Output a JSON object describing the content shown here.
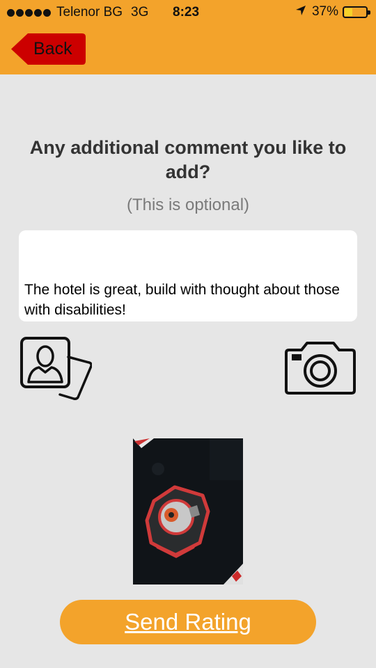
{
  "status_bar": {
    "carrier": "Telenor BG",
    "network": "3G",
    "time": "8:23",
    "battery_percent": "37%",
    "battery_level": 0.37,
    "location_icon": "location-arrow-icon"
  },
  "nav": {
    "back_label": "Back",
    "back_color": "#cc0000",
    "bar_color": "#f3a32b"
  },
  "content": {
    "prompt_title": "Any additional comment you like to add?",
    "optional_note": "(This is optional)",
    "comment_text": "The hotel is great, build with thought about those with disabilities!",
    "gallery_icon": "photo-gallery-icon",
    "camera_icon": "camera-icon"
  },
  "send_button": {
    "label": "Send Rating",
    "color": "#f3a32b"
  }
}
